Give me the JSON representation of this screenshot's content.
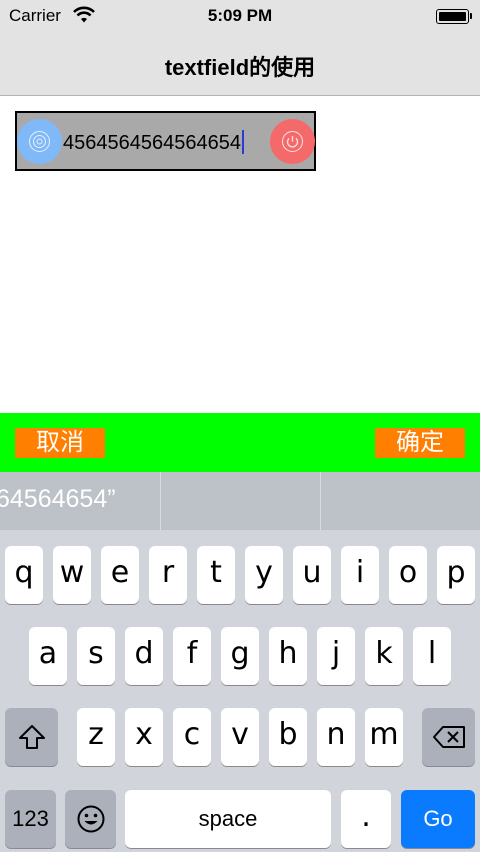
{
  "status_bar": {
    "carrier": "Carrier",
    "time": "5:09 PM"
  },
  "nav": {
    "title": "textfield的使用"
  },
  "textfield": {
    "value": "4564564564564654",
    "left_icon": "spiral-icon",
    "right_icon": "power-icon",
    "colors": {
      "left_circle": "#80b9f7",
      "right_circle": "#f46a6b",
      "background": "#a9a9a9"
    }
  },
  "toolbar": {
    "cancel_label": "取消",
    "confirm_label": "确定",
    "colors": {
      "bar": "#00ff00",
      "button": "#ff7f00"
    }
  },
  "keyboard": {
    "suggestion": "64564654”",
    "row1": [
      "q",
      "w",
      "e",
      "r",
      "t",
      "y",
      "u",
      "i",
      "o",
      "p"
    ],
    "row2": [
      "a",
      "s",
      "d",
      "f",
      "g",
      "h",
      "j",
      "k",
      "l"
    ],
    "row3": [
      "z",
      "x",
      "c",
      "v",
      "b",
      "n",
      "m"
    ],
    "numbers_label": "123",
    "space_label": "space",
    "period_label": ".",
    "go_label": "Go",
    "icons": {
      "shift": "shift-arrow-icon",
      "delete": "backspace-icon",
      "emoji": "emoji-icon"
    },
    "colors": {
      "go": "#0a7bff"
    }
  }
}
